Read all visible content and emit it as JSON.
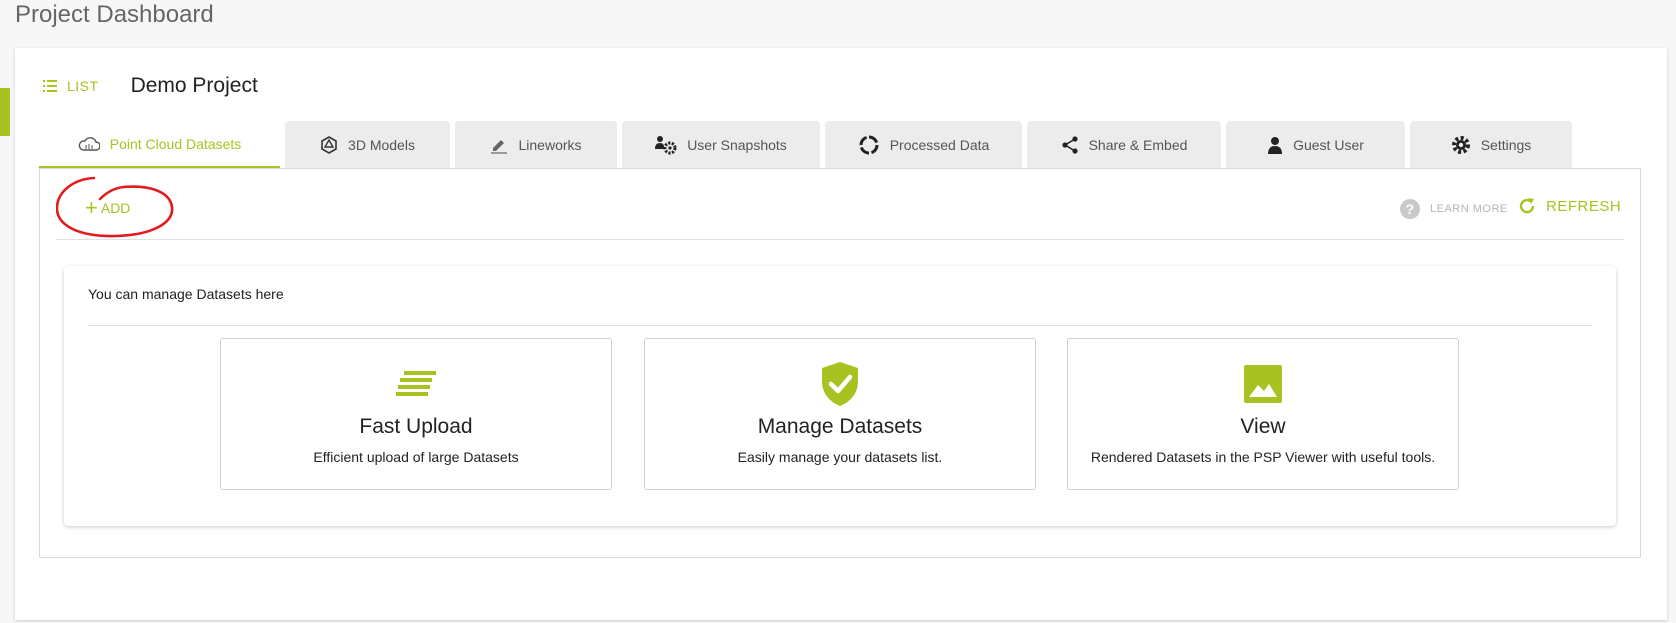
{
  "page": {
    "title": "Project Dashboard"
  },
  "header": {
    "list_label": "LIST",
    "project_name": "Demo Project"
  },
  "tabs": [
    {
      "label": "Point Cloud Datasets",
      "icon": "cloud-icon",
      "active": true
    },
    {
      "label": "3D Models",
      "icon": "model-3d-icon"
    },
    {
      "label": "Lineworks",
      "icon": "pen-icon"
    },
    {
      "label": "User Snapshots",
      "icon": "user-gear-icon"
    },
    {
      "label": "Processed Data",
      "icon": "circle-notch-icon"
    },
    {
      "label": "Share & Embed",
      "icon": "share-icon"
    },
    {
      "label": "Guest User",
      "icon": "user-icon"
    },
    {
      "label": "Settings",
      "icon": "gear-icon"
    }
  ],
  "toolbar": {
    "add_label": "ADD",
    "learn_more_label": "LEARN MORE",
    "refresh_label": "REFRESH"
  },
  "info": {
    "text": "You can manage Datasets here",
    "features": [
      {
        "title": "Fast Upload",
        "desc": "Efficient upload of large Datasets",
        "icon": "lines-icon"
      },
      {
        "title": "Manage Datasets",
        "desc": "Easily manage your datasets list.",
        "icon": "shield-check-icon"
      },
      {
        "title": "View",
        "desc": "Rendered Datasets in the PSP Viewer with useful tools.",
        "icon": "image-icon"
      }
    ]
  },
  "colors": {
    "accent": "#a8c321",
    "annotation": "#e01c1c"
  }
}
